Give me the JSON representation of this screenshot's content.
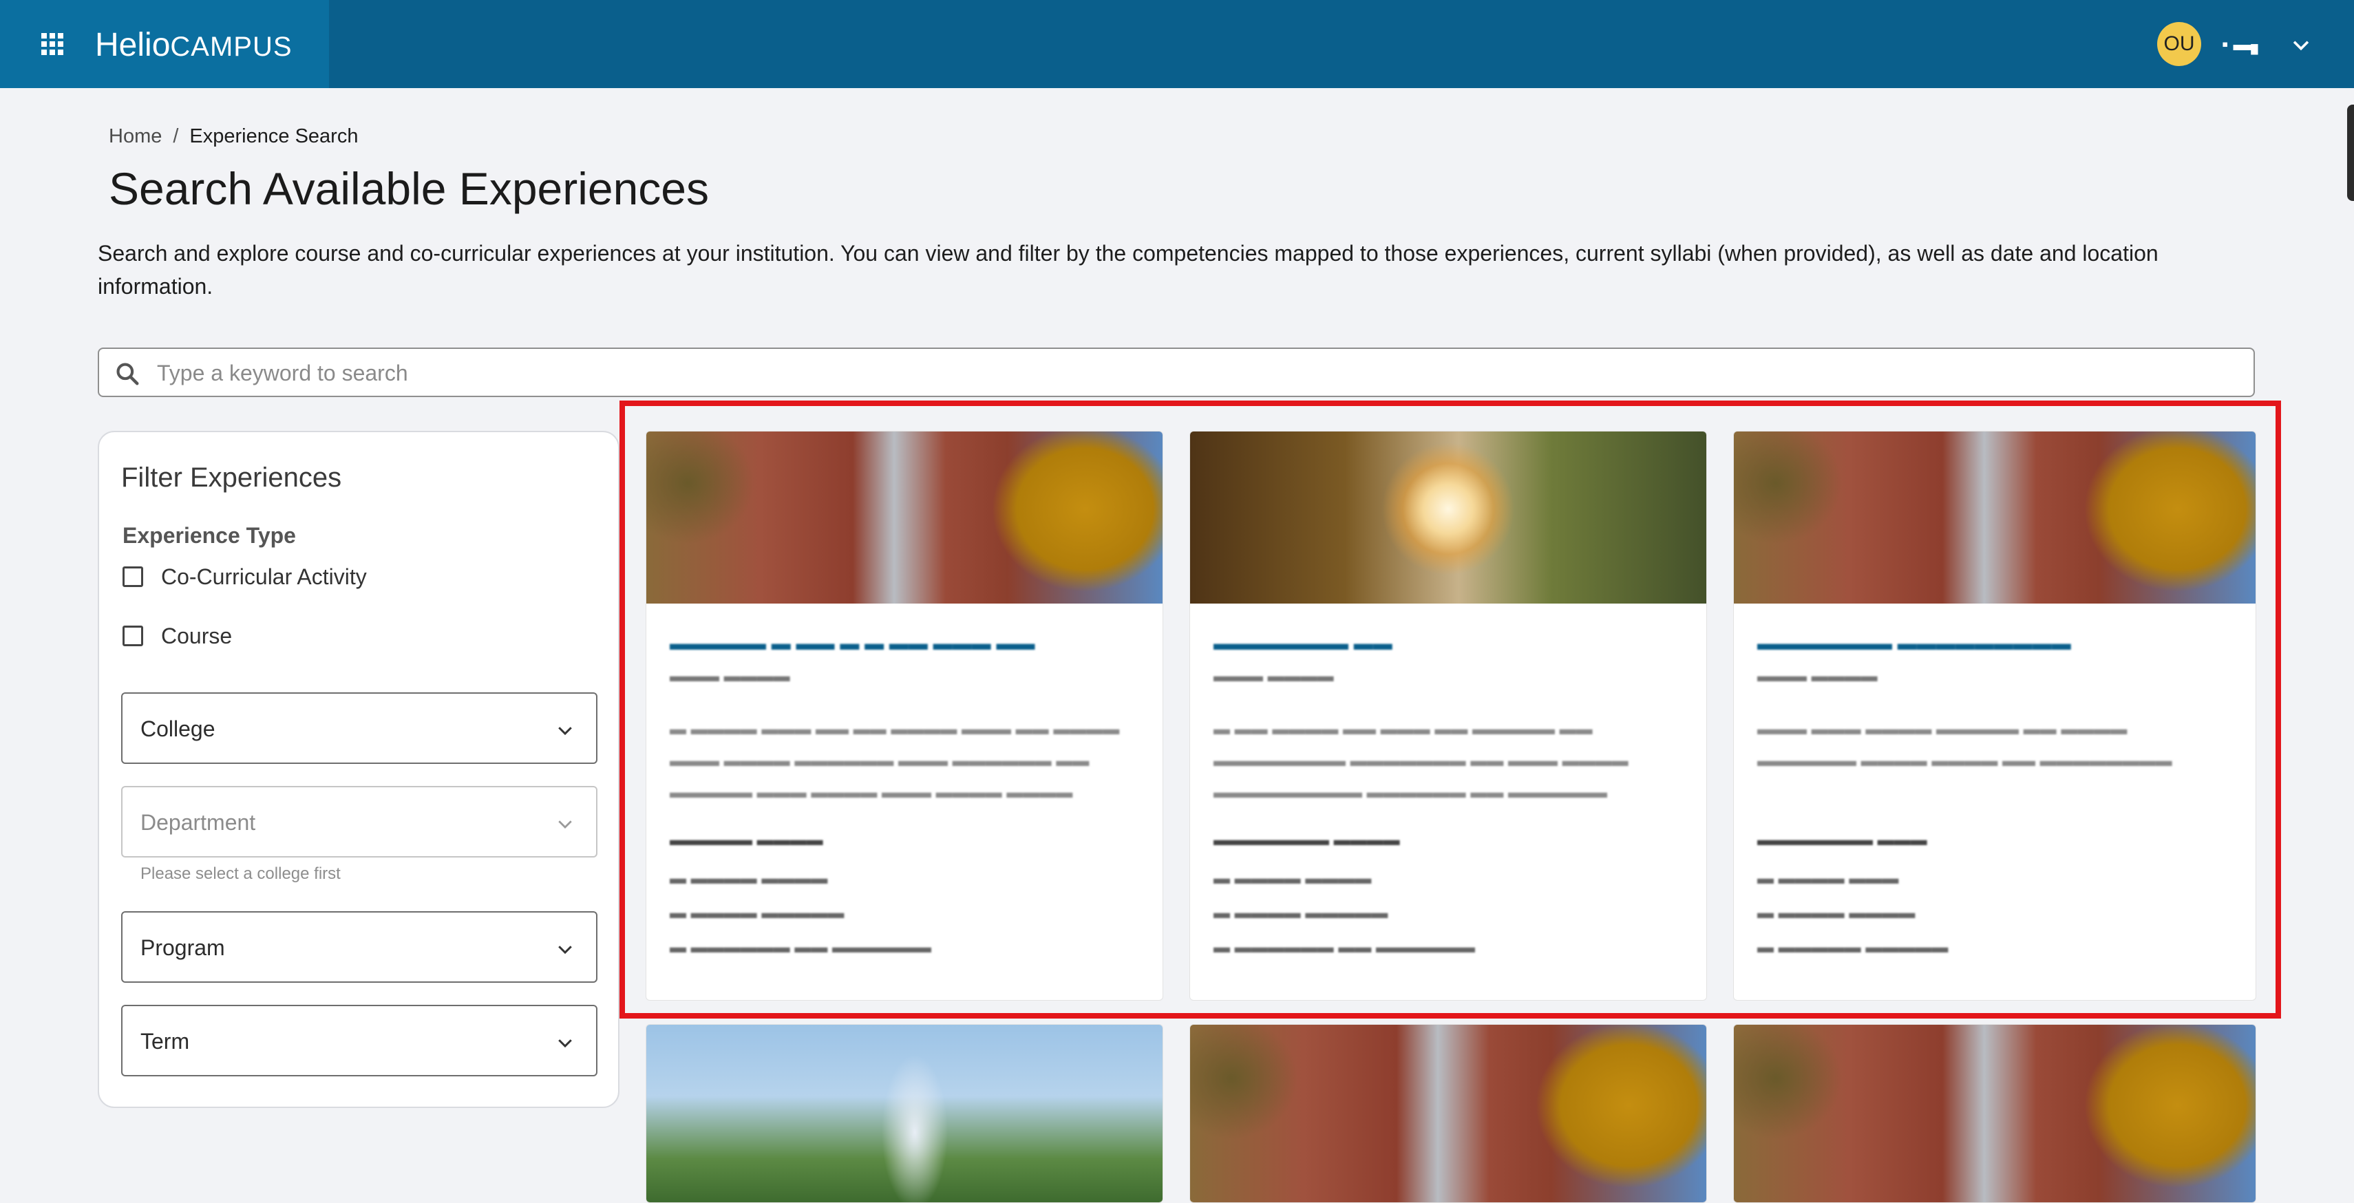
{
  "header": {
    "brand_part1": "Helio",
    "brand_part2": "CAMPUS",
    "avatar_initials": "OU",
    "user_name": "▪ ▬▖",
    "colors": {
      "bar": "#0a5f8c",
      "brand_panel": "#0b6fa0",
      "avatar": "#f2c94c"
    }
  },
  "breadcrumb": {
    "home": "Home",
    "separator": "/",
    "current": "Experience Search"
  },
  "page": {
    "title": "Search Available Experiences",
    "description": "Search and explore course and co-curricular experiences at your institution. You can view and filter by the competencies mapped to those experiences, current syllabi (when provided), as well as date and location information."
  },
  "search": {
    "placeholder": "Type a keyword to search",
    "value": ""
  },
  "filters": {
    "title": "Filter Experiences",
    "experience_type_label": "Experience Type",
    "options": [
      {
        "label": "Co-Curricular Activity",
        "checked": false
      },
      {
        "label": "Course",
        "checked": false
      }
    ],
    "college": "College",
    "department": "Department",
    "department_helper": "Please select a college first",
    "program": "Program",
    "term": "Term"
  },
  "highlight_color": "#e3161b",
  "cards": [
    {
      "photo": "campus-building",
      "title": "▬▬▬▬▬ ▬ ▬▬ ▬ ▬ ▬▬ ▬▬▬ ▬▬",
      "subtitle": "▬▬▬ ▬▬▬▬",
      "description": "▬ ▬▬▬▬ ▬▬▬ ▬▬ ▬▬ ▬▬▬▬ ▬▬▬ ▬▬ ▬▬▬▬ ▬▬▬ ▬▬▬▬ ▬▬▬▬▬▬ ▬▬▬ ▬▬▬▬▬▬ ▬▬ ▬▬▬▬▬ ▬▬▬ ▬▬▬▬ ▬▬▬ ▬▬▬▬ ▬▬▬▬ ▬▬▬▬▬",
      "section": "▬▬▬▬▬ ▬▬▬▬",
      "lines": [
        "▬ ▬▬▬▬ ▬▬▬▬",
        "▬ ▬▬▬▬ ▬▬▬▬▬",
        "▬ ▬▬▬▬▬▬ ▬▬ ▬▬▬▬▬▬"
      ]
    },
    {
      "photo": "sun-through-trees",
      "title": "▬▬▬▬▬▬▬ ▬▬",
      "subtitle": "▬▬▬ ▬▬▬▬",
      "description": "▬ ▬▬ ▬▬▬▬ ▬▬ ▬▬▬ ▬▬ ▬▬▬▬▬ ▬▬ ▬▬▬▬▬▬▬▬ ▬▬▬▬▬▬▬ ▬▬ ▬▬▬ ▬▬▬▬ ▬▬▬▬▬▬▬▬▬ ▬▬▬▬▬▬ ▬▬ ▬▬▬▬▬▬ ▬▬▬▬▬",
      "section": "▬▬▬▬▬▬▬ ▬▬▬▬",
      "lines": [
        "▬ ▬▬▬▬ ▬▬▬▬",
        "▬ ▬▬▬▬ ▬▬▬▬▬",
        "▬ ▬▬▬▬▬▬ ▬▬ ▬▬▬▬▬▬"
      ]
    },
    {
      "photo": "campus-building",
      "title": "▬▬▬▬▬▬▬ ▬▬▬▬▬▬▬▬▬",
      "subtitle": "▬▬▬ ▬▬▬▬",
      "description": "▬▬▬ ▬▬▬ ▬▬▬▬ ▬▬▬▬▬ ▬▬ ▬▬▬▬ ▬▬▬▬▬▬ ▬▬▬▬ ▬▬▬▬ ▬▬ ▬▬▬▬▬▬▬▬",
      "section": "▬▬▬▬▬▬▬ ▬▬▬",
      "lines": [
        "▬ ▬▬▬▬ ▬▬▬",
        "▬ ▬▬▬▬ ▬▬▬▬",
        "▬ ▬▬▬▬▬ ▬▬▬▬▬"
      ]
    },
    {
      "photo": "fountain"
    },
    {
      "photo": "campus-building"
    },
    {
      "photo": "campus-building"
    }
  ]
}
